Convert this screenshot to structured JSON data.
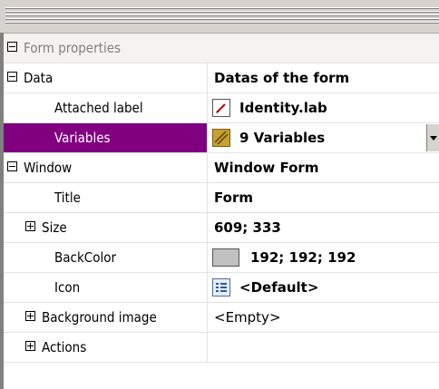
{
  "header": {
    "title": "Form properties"
  },
  "data_section": {
    "label": "Data",
    "value": "Datas of the form",
    "attached_label": {
      "name": "Attached label",
      "value": "Identity.lab",
      "icon": "label-file-icon"
    },
    "variables": {
      "name": "Variables",
      "value": "9 Variables",
      "icon": "variables-icon"
    }
  },
  "window_section": {
    "label": "Window",
    "value": "Window Form",
    "title": {
      "name": "Title",
      "value": "Form"
    },
    "size": {
      "name": "Size",
      "value": "609; 333"
    },
    "backcolor": {
      "name": "BackColor",
      "value": "192; 192; 192",
      "swatch": "#c0c0c0"
    },
    "icon": {
      "name": "Icon",
      "value": "<Default>",
      "icon": "default-form-icon"
    },
    "background_image": {
      "name": "Background image",
      "value": "<Empty>"
    },
    "actions": {
      "name": "Actions",
      "value": ""
    }
  },
  "colors": {
    "selection": "#800080",
    "grid_line": "#e3e3e3",
    "header_text": "#808080"
  }
}
